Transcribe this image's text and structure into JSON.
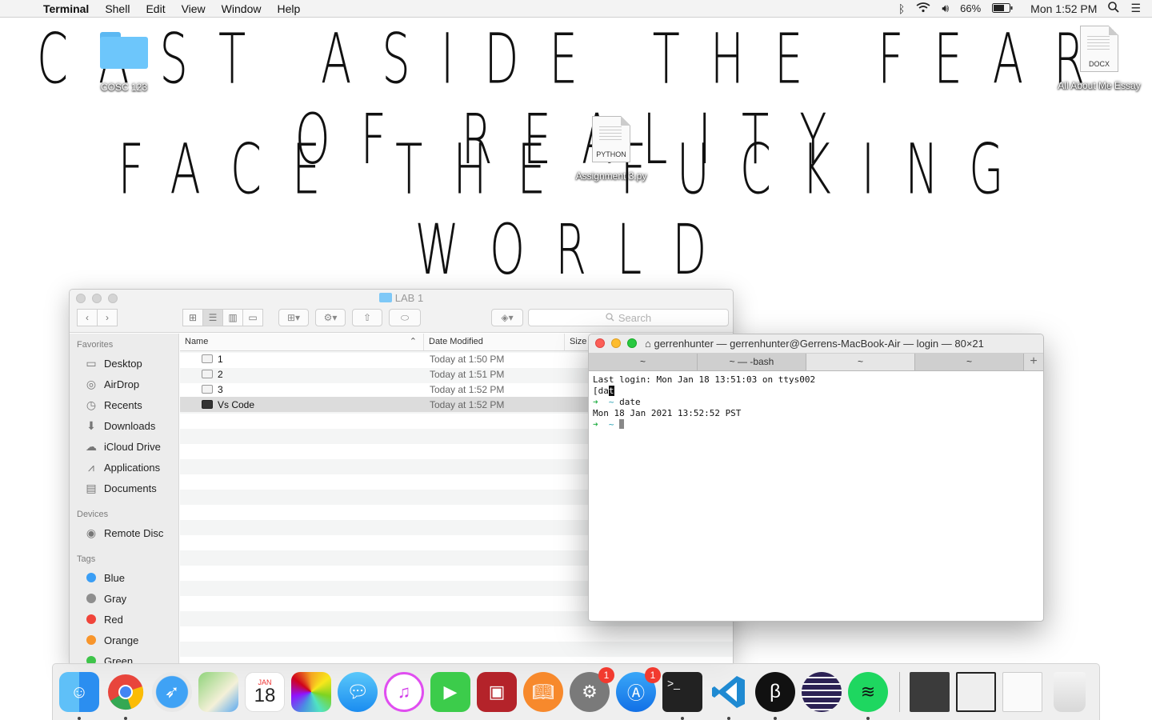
{
  "menubar": {
    "app_name": "Terminal",
    "menus": [
      "Shell",
      "Edit",
      "View",
      "Window",
      "Help"
    ],
    "battery": "66%",
    "clock": "Mon 1:52 PM"
  },
  "wallpaper": {
    "line1": "CAST ASIDE THE FEAR OF REALITY",
    "line2": "FACE THE FUCKING WORLD"
  },
  "desktop_icons": {
    "folder_label": "COSC 123",
    "docx_label": "All About Me Essay",
    "docx_kind": "DOCX",
    "python_label": "Assignment 3.py",
    "python_kind": "PYTHON"
  },
  "finder": {
    "title": "LAB 1",
    "search_placeholder": "Search",
    "sidebar": {
      "favorites_label": "Favorites",
      "favorites": [
        "Desktop",
        "AirDrop",
        "Recents",
        "Downloads",
        "iCloud Drive",
        "Applications",
        "Documents"
      ],
      "devices_label": "Devices",
      "devices": [
        "Remote Disc"
      ],
      "tags_label": "Tags",
      "tags": [
        {
          "name": "Blue",
          "color": "#3a9ef5"
        },
        {
          "name": "Gray",
          "color": "#8e8e8e"
        },
        {
          "name": "Red",
          "color": "#f0443a"
        },
        {
          "name": "Orange",
          "color": "#f8952b"
        },
        {
          "name": "Green",
          "color": "#3ec44a"
        }
      ]
    },
    "columns": {
      "name": "Name",
      "date": "Date Modified",
      "size": "Size"
    },
    "rows": [
      {
        "name": "1",
        "date": "Today at 1:50 PM"
      },
      {
        "name": "2",
        "date": "Today at 1:51 PM"
      },
      {
        "name": "3",
        "date": "Today at 1:52 PM"
      },
      {
        "name": "Vs Code",
        "date": "Today at 1:52 PM"
      }
    ]
  },
  "terminal": {
    "title": "gerrenhunter — gerrenhunter@Gerrens-MacBook-Air — login — 80×21",
    "tabs": [
      "~",
      "~ — -bash",
      "~",
      "~"
    ],
    "line1": "Last login: Mon Jan 18 13:51:03 on ttys002",
    "line2_prefix": "[da",
    "line2_sel": "t",
    "prompt_arrow": "➜",
    "prompt_dir": "~",
    "command": "date",
    "output": "Mon 18 Jan 2021 13:52:52 PST"
  },
  "dock": {
    "calendar_month": "JAN",
    "calendar_day": "18",
    "badge_prefs": "1",
    "badge_appstore": "1",
    "items": [
      "finder-icon",
      "chrome-icon",
      "safari-icon",
      "maps-icon",
      "calendar-icon",
      "photos-icon",
      "messages-icon",
      "itunes-icon",
      "facetime-icon",
      "photo-booth-icon",
      "ibooks-icon",
      "system-preferences-icon",
      "app-store-icon",
      "terminal-icon",
      "vscode-icon",
      "bb-icon",
      "eclipse-icon",
      "spotify-icon"
    ]
  }
}
